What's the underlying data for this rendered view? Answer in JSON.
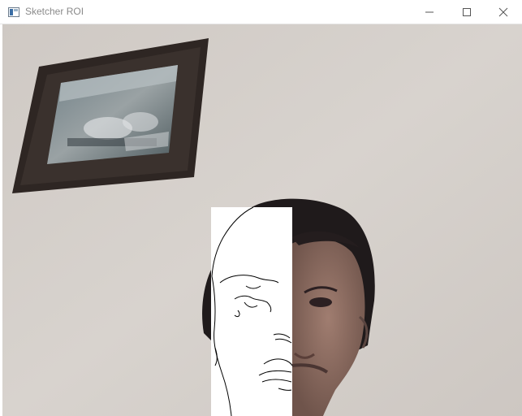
{
  "window": {
    "title": "Sketcher ROI",
    "icon": "opencv-window-icon",
    "controls": {
      "minimize": "minimize-icon",
      "maximize": "maximize-icon",
      "close": "close-icon"
    }
  },
  "colors": {
    "wall": "#d6d0cb",
    "frame": "#2e2623",
    "sketch_background": "#ffffff",
    "sketch_lines": "#000000",
    "hair": "#1f1a1b",
    "skin": "#8a6b62"
  }
}
